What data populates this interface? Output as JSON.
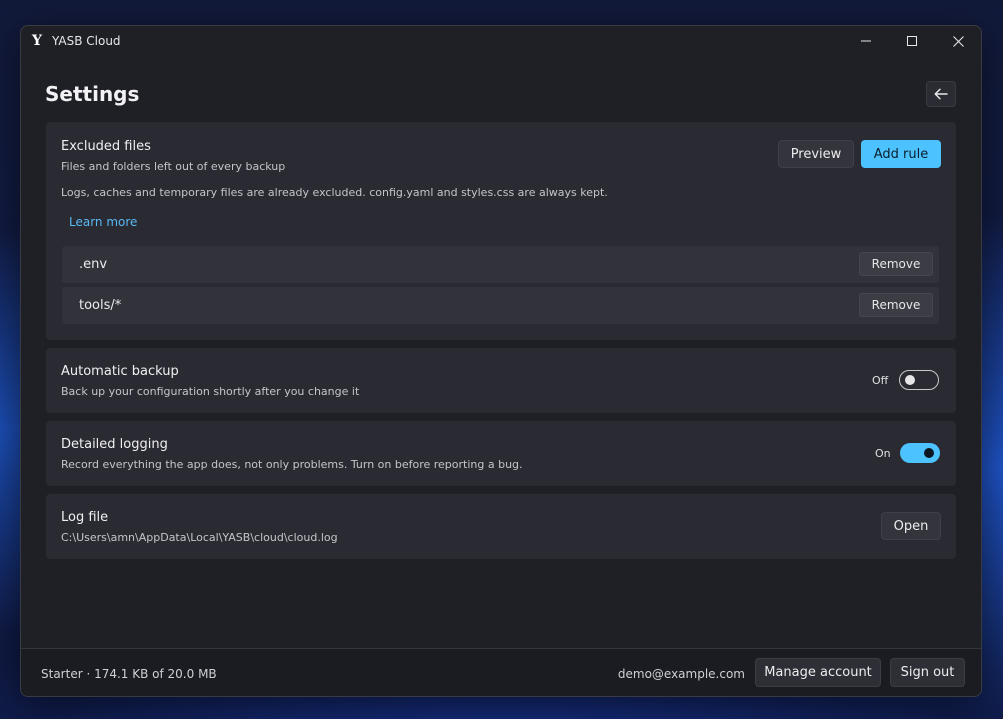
{
  "window": {
    "title": "YASB Cloud",
    "logo_letter": "Y"
  },
  "page": {
    "title": "Settings"
  },
  "excluded_files": {
    "title": "Excluded files",
    "subtitle": "Files and folders left out of every backup",
    "note": "Logs, caches and temporary files are already excluded. config.yaml and styles.css are always kept.",
    "learn_more": "Learn more",
    "preview_label": "Preview",
    "add_rule_label": "Add rule",
    "rules": [
      {
        "pattern": ".env",
        "remove_label": "Remove"
      },
      {
        "pattern": "tools/*",
        "remove_label": "Remove"
      }
    ]
  },
  "automatic_backup": {
    "title": "Automatic backup",
    "subtitle": "Back up your configuration shortly after you change it",
    "state_label": "Off",
    "enabled": false
  },
  "detailed_logging": {
    "title": "Detailed logging",
    "subtitle": "Record everything the app does, not only problems. Turn on before reporting a bug.",
    "state_label": "On",
    "enabled": true
  },
  "log_file": {
    "title": "Log file",
    "path": "C:\\Users\\amn\\AppData\\Local\\YASB\\cloud\\cloud.log",
    "open_label": "Open"
  },
  "footer": {
    "plan_usage": "Starter · 174.1 KB of 20.0 MB",
    "email": "demo@example.com",
    "manage_label": "Manage account",
    "signout_label": "Sign out"
  },
  "colors": {
    "accent": "#4cc2ff",
    "link": "#58b8f5",
    "card": "#2a2b32",
    "window": "#1f2026"
  }
}
